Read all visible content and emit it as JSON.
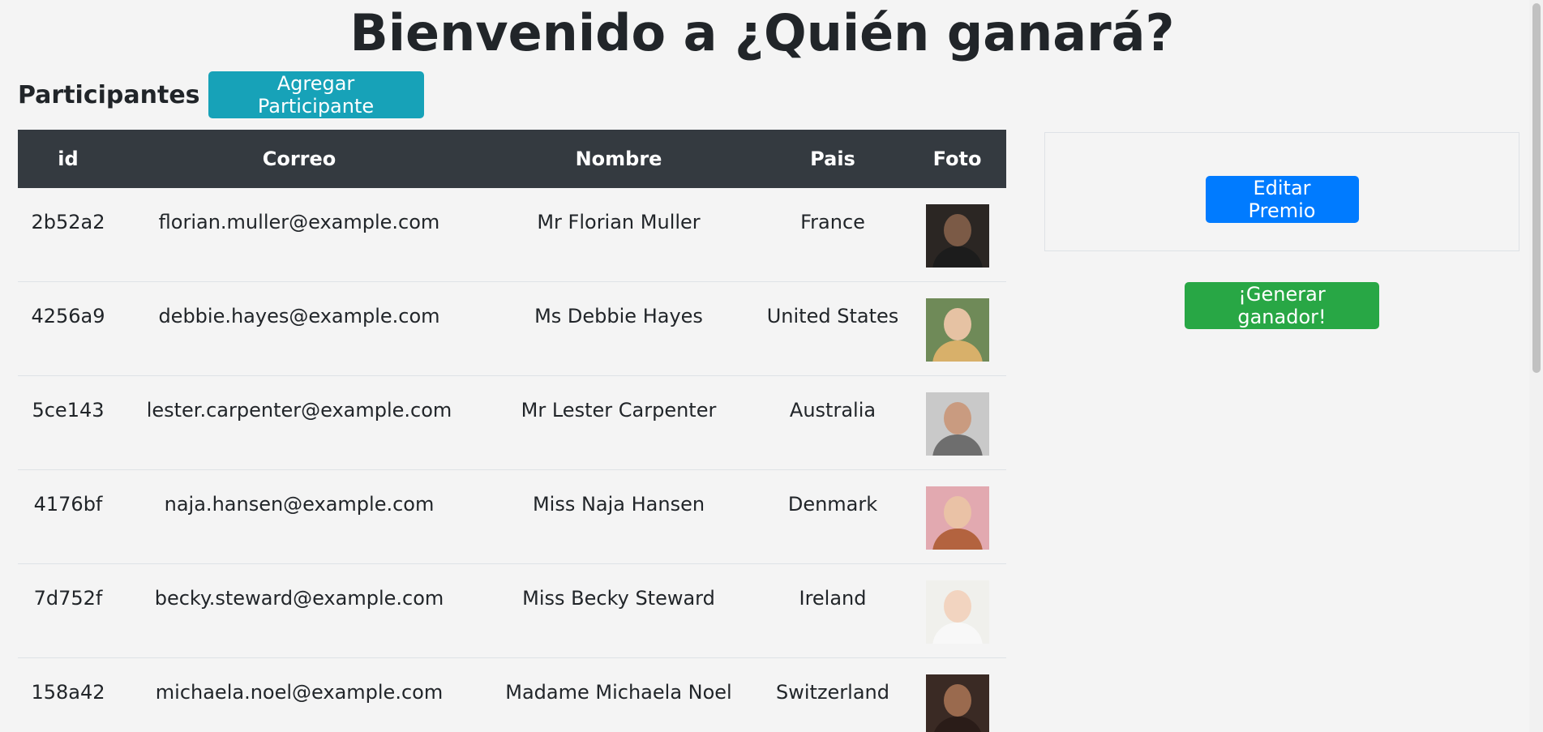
{
  "page": {
    "title": "Bienvenido a ¿Quién ganará?"
  },
  "participants": {
    "section_title": "Participantes",
    "add_button": "Agregar Participante",
    "columns": [
      "id",
      "Correo",
      "Nombre",
      "Pais",
      "Foto"
    ],
    "rows": [
      {
        "id": "2b52a2",
        "email": "florian.muller@example.com",
        "name": "Mr Florian Muller",
        "country": "France",
        "photo": {
          "bg": "#2b2623",
          "skin": "#7b5a46",
          "shirt": "#1c1c1c"
        }
      },
      {
        "id": "4256a9",
        "email": "debbie.hayes@example.com",
        "name": "Ms Debbie Hayes",
        "country": "United States",
        "photo": {
          "bg": "#6f8a58",
          "skin": "#e6c2a3",
          "shirt": "#d8b06a"
        }
      },
      {
        "id": "5ce143",
        "email": "lester.carpenter@example.com",
        "name": "Mr Lester Carpenter",
        "country": "Australia",
        "photo": {
          "bg": "#c9c9c9",
          "skin": "#c99b80",
          "shirt": "#6e6e6e"
        }
      },
      {
        "id": "4176bf",
        "email": "naja.hansen@example.com",
        "name": "Miss Naja Hansen",
        "country": "Denmark",
        "photo": {
          "bg": "#e2a9b0",
          "skin": "#eac2a6",
          "shirt": "#b3633f"
        }
      },
      {
        "id": "7d752f",
        "email": "becky.steward@example.com",
        "name": "Miss Becky Steward",
        "country": "Ireland",
        "photo": {
          "bg": "#f0f0ec",
          "skin": "#f2d4c0",
          "shirt": "#f8f8f8"
        }
      },
      {
        "id": "158a42",
        "email": "michaela.noel@example.com",
        "name": "Madame Michaela Noel",
        "country": "Switzerland",
        "photo": {
          "bg": "#3a2a24",
          "skin": "#9a6a4e",
          "shirt": "#2a1c18"
        }
      }
    ]
  },
  "prize": {
    "edit_button": "Editar Premio"
  },
  "winner": {
    "generate_button": "¡Generar ganador!"
  },
  "colors": {
    "header_bg": "#343a40",
    "info": "#17a2b8",
    "primary": "#007bff",
    "success": "#28a745"
  }
}
